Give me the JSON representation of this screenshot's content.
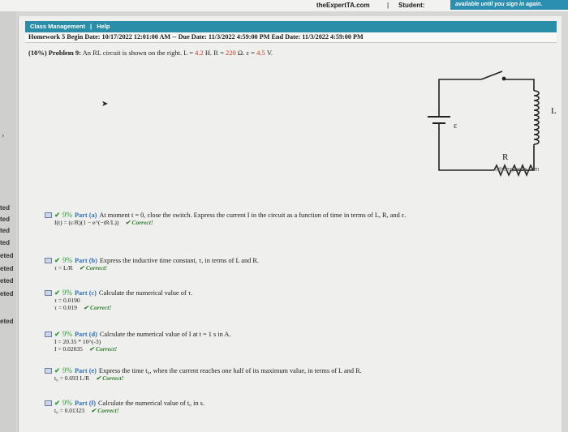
{
  "topbar": {
    "brand": "theExpertTA.com",
    "separator": "|",
    "student": "Student:",
    "banner": "available until you sign in again."
  },
  "sidebar": {
    "arrow": "›",
    "statuses": [
      "ted",
      "ted",
      "ted",
      "ted",
      "eted",
      "eted",
      "eted",
      "eted",
      "eted"
    ]
  },
  "menu": {
    "item1": "Class Management",
    "sep": "|",
    "item2": "Help"
  },
  "dates": "Homework 5 Begin Date: 10/17/2022 12:01:00 AM -- Due Date: 11/3/2022 4:59:00 PM End Date: 11/3/2022 4:59:00 PM",
  "problem": {
    "label": "(10%) Problem 9:",
    "text": "An RL circuit is shown on the right.",
    "L_eq": "L = ",
    "L_val": "4.2",
    "L_unit": " H.",
    "R_eq": " R = ",
    "R_val": "220",
    "R_unit": " Ω.",
    "e_eq": " ε = ",
    "e_val": "4.5",
    "e_unit": " V."
  },
  "circuit": {
    "L": "L",
    "R": "R",
    "E": "ε"
  },
  "credit": "©theexpertta.com",
  "correct_label": "Correct!",
  "parts": [
    {
      "pct": "9%",
      "label": "Part (a)",
      "prompt": "At moment t = 0, close the switch. Express the current I in the circuit as a function of time in terms of L, R, and ε.",
      "answers": [
        "I(t) = (ε/R)(1 − e^(−tR/L))"
      ]
    },
    {
      "pct": "9%",
      "label": "Part (b)",
      "prompt": "Express the inductive time constant, τ, in terms of L and R.",
      "answers": [
        "τ = L/R"
      ]
    },
    {
      "pct": "9%",
      "label": "Part (c)",
      "prompt": "Calculate the numerical value of τ.",
      "answers": [
        "τ = 0.0190",
        "τ = 0.019"
      ]
    },
    {
      "pct": "9%",
      "label": "Part (d)",
      "prompt": "Calculate the numerical value of I at t = 1 s in A.",
      "answers": [
        "I = 20.35 * 10^(-3)",
        "I = 0.02035"
      ]
    },
    {
      "pct": "9%",
      "label": "Part (e)",
      "prompt": "Express the time t₀, when the current reaches one half of its maximum value, in terms of L and R.",
      "answers": [
        "t₀ = 0.693 L/R"
      ]
    },
    {
      "pct": "9%",
      "label": "Part (f)",
      "prompt": "Calculate the numerical value of t₀ in s.",
      "answers": [
        "t₀ = 0.01323"
      ]
    }
  ]
}
